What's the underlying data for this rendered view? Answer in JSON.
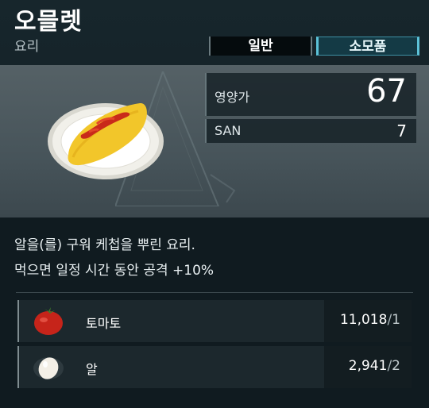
{
  "item": {
    "name": "오믈렛",
    "category": "요리"
  },
  "tabs": [
    {
      "label": "일반",
      "active": false
    },
    {
      "label": "소모품",
      "active": true
    }
  ],
  "stats": {
    "nutrition_label": "영양가",
    "nutrition_value": "67",
    "san_label": "SAN",
    "san_value": "7"
  },
  "description": {
    "line1": "알을(를) 구워 케첩을 뿌린 요리.",
    "line2": "먹으면 일정 시간 동안 공격 +10%"
  },
  "ingredients": [
    {
      "name": "토마토",
      "icon": "tomato-icon",
      "have": "11,018",
      "need": "1"
    },
    {
      "name": "알",
      "icon": "egg-icon",
      "have": "2,941",
      "need": "2"
    }
  ],
  "colors": {
    "accent": "#5cc2d8",
    "background": "#0f1a1f"
  }
}
